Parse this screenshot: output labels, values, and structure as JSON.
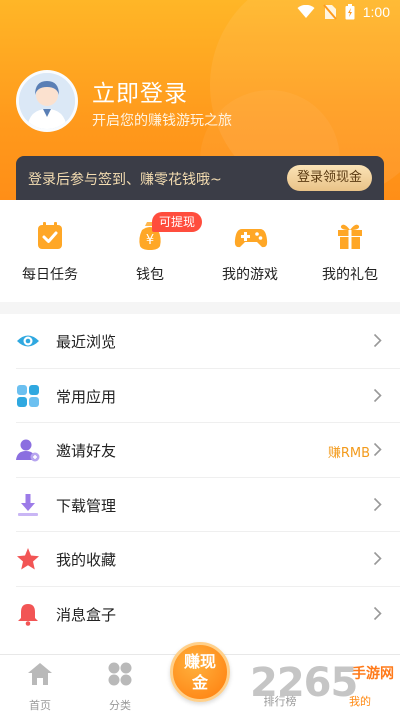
{
  "status_bar": {
    "time": "1:00"
  },
  "profile": {
    "login_title": "立即登录",
    "login_subtitle": "开启您的赚钱游玩之旅"
  },
  "promo": {
    "text": "登录后参与签到、赚零花钱哦~",
    "button": "登录领现金"
  },
  "quick_actions": [
    {
      "label": "每日任务",
      "icon": "daily-task-icon"
    },
    {
      "label": "钱包",
      "icon": "wallet-icon",
      "badge": "可提现"
    },
    {
      "label": "我的游戏",
      "icon": "gamepad-icon"
    },
    {
      "label": "我的礼包",
      "icon": "gift-icon"
    }
  ],
  "menu": [
    {
      "label": "最近浏览",
      "icon": "eye-icon"
    },
    {
      "label": "常用应用",
      "icon": "apps-icon"
    },
    {
      "label": "邀请好友",
      "icon": "invite-friend-icon",
      "extra": "赚RMB"
    },
    {
      "label": "下载管理",
      "icon": "download-icon"
    },
    {
      "label": "我的收藏",
      "icon": "star-icon"
    },
    {
      "label": "消息盒子",
      "icon": "bell-icon"
    }
  ],
  "tabbar": {
    "home": "首页",
    "category": "分类",
    "earn": "赚现金",
    "ranking": "排行榜",
    "mine": "我的"
  },
  "watermark": {
    "main": "2265",
    "sub": "手游网"
  },
  "colors": {
    "accent": "#ff9a1c",
    "promo_bg": "#3b3d47",
    "badge": "#ff4d3d"
  }
}
